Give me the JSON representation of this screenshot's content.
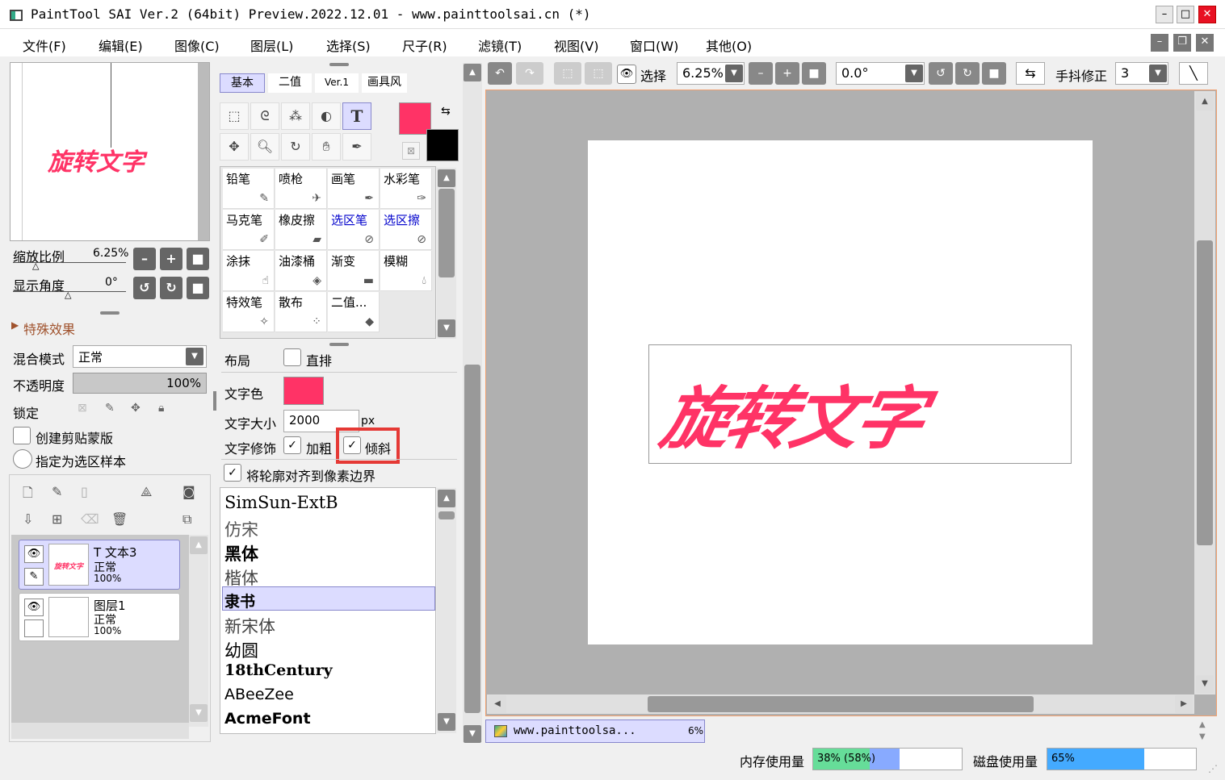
{
  "title": "PaintTool SAI Ver.2 (64bit) Preview.2022.12.01 - www.painttoolsai.cn (*)",
  "menu": [
    "文件(F)",
    "编辑(E)",
    "图像(C)",
    "图层(L)",
    "选择(S)",
    "尺子(R)",
    "滤镜(T)",
    "视图(V)",
    "窗口(W)",
    "其他(O)"
  ],
  "nav": {
    "zoom_label": "缩放比例",
    "zoom_value": "6.25%",
    "angle_label": "显示角度",
    "angle_value": "0°",
    "thumb_text": "旋转文字"
  },
  "effects": {
    "label": "特殊效果"
  },
  "layerprops": {
    "blend_label": "混合模式",
    "blend_value": "正常",
    "opacity_label": "不透明度",
    "opacity_value": "100%",
    "lock_label": "锁定",
    "clip_label": "创建剪贴蒙版",
    "sample_label": "指定为选区样本"
  },
  "layers": [
    {
      "name": "T 文本3",
      "mode": "正常",
      "opacity": "100%",
      "thumb": "旋转文字"
    },
    {
      "name": "图层1",
      "mode": "正常",
      "opacity": "100%"
    }
  ],
  "tooltabs": [
    "基本",
    "二值",
    "Ver.1",
    "画具风"
  ],
  "brushes": [
    "铅笔",
    "喷枪",
    "画笔",
    "水彩笔",
    "马克笔",
    "橡皮擦",
    "选区笔",
    "选区擦",
    "涂抹",
    "油漆桶",
    "渐变",
    "模糊",
    "特效笔",
    "散布",
    "二值..."
  ],
  "textopts": {
    "layout_label": "布局",
    "vertical_label": "直排",
    "color_label": "文字色",
    "size_label": "文字大小",
    "size_value": "2000",
    "size_unit": "px",
    "deco_label": "文字修饰",
    "bold_label": "加粗",
    "italic_label": "倾斜",
    "align_label": "将轮廓对齐到像素边界"
  },
  "fonts": [
    "SimSun-ExtB",
    "仿宋",
    "黑体",
    "楷体",
    "隶书",
    "新宋体",
    "幼圆",
    "18thCentury",
    "ABeeZee",
    "AcmeFont"
  ],
  "toolbar": {
    "select_label": "选择",
    "zoom_value": "6.25%",
    "angle_value": "0.0°",
    "stab_label": "手抖修正",
    "stab_value": "3"
  },
  "canvas": {
    "text": "旋转文字"
  },
  "status": {
    "tab_title": "www.painttoolsa...",
    "tab_pct": "6%",
    "mem_label": "内存使用量",
    "mem_value": "38% (58%)",
    "disk_label": "磁盘使用量",
    "disk_value": "65%",
    "mem_fill": 0.38,
    "mem_fill2": 0.58,
    "disk_fill": 0.65
  },
  "colors": {
    "accent": "#ff3366",
    "highlight": "#e53935",
    "selection": "#dcdcff"
  }
}
